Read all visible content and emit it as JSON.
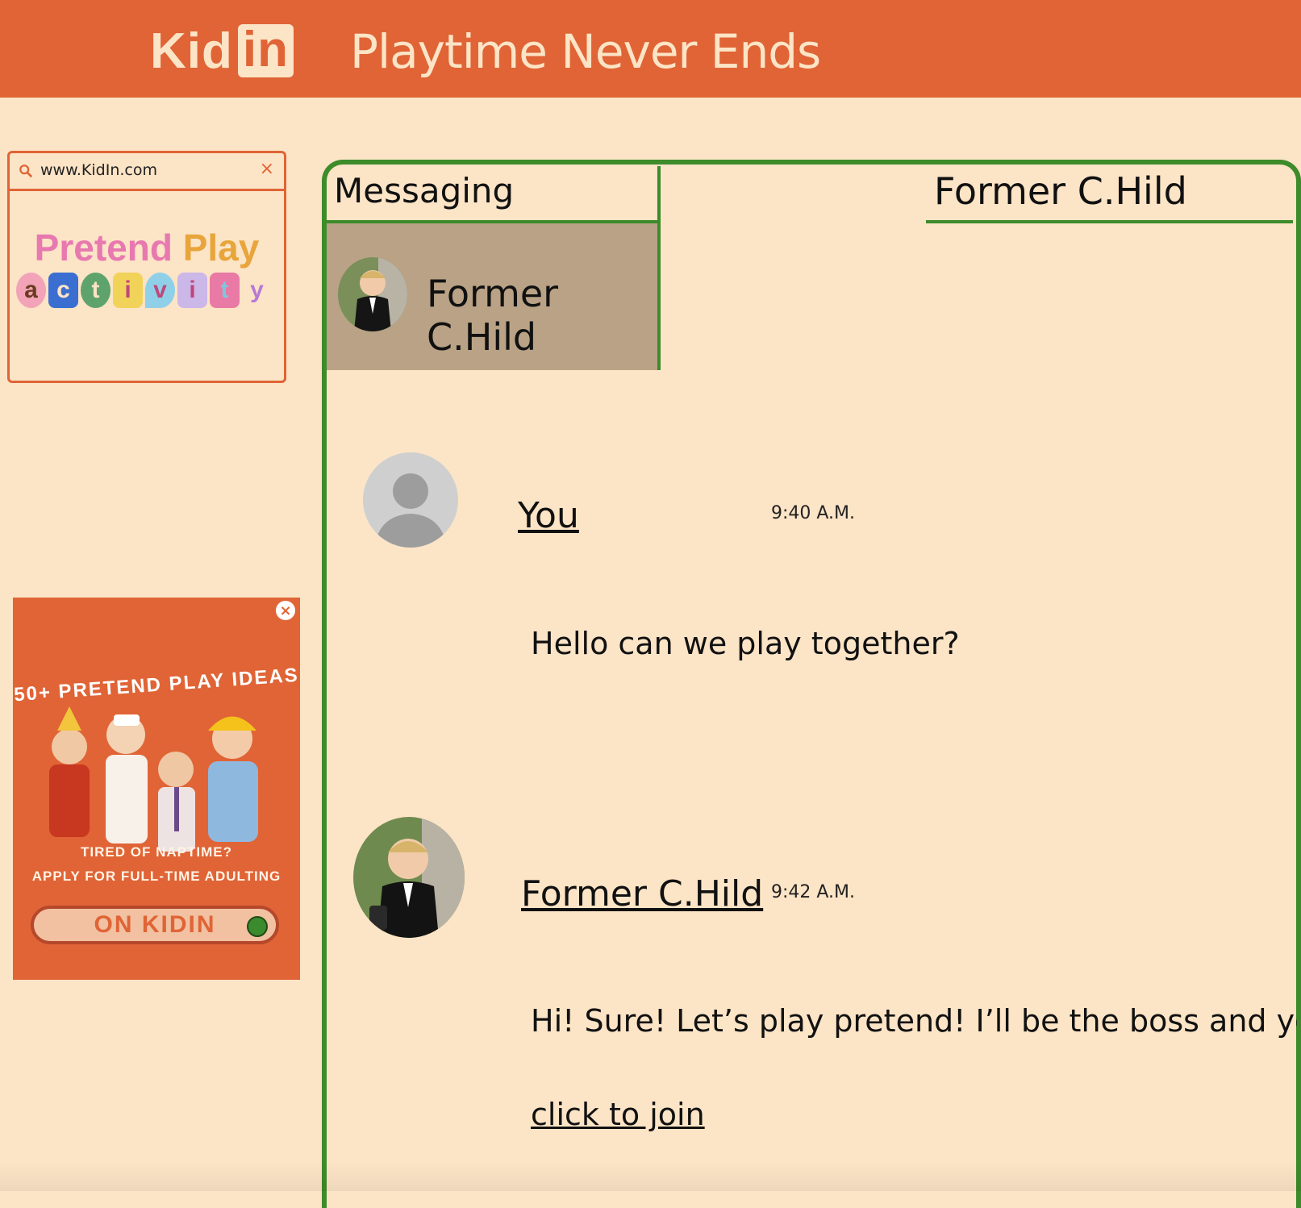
{
  "header": {
    "logo_text": "Kid",
    "logo_badge": "in",
    "tagline": "Playtime Never Ends",
    "background_color": "#e06436"
  },
  "sidebar_card": {
    "url": "www.KidIn.com",
    "close_glyph": "×",
    "title_word1": "Pretend",
    "title_word2": "Play",
    "activity_letters": [
      "a",
      "c",
      "t",
      "i",
      "v",
      "i",
      "t",
      "y"
    ]
  },
  "ad": {
    "headline": "50+ PRETEND PLAY IDEAS",
    "subline1": "TIRED OF NAPTIME?",
    "subline2": "APPLY FOR FULL-TIME ADULTING",
    "cta": "ON KIDIN",
    "close_glyph": "×"
  },
  "messaging": {
    "heading": "Messaging",
    "contacts": [
      {
        "name": "Former C.Hild"
      }
    ],
    "conversation_title": "Former C.Hild",
    "messages": [
      {
        "author": "You",
        "time": "9:40 A.M.",
        "body": "Hello can we play together?"
      },
      {
        "author": "Former C.Hild",
        "time": "9:42 A.M.",
        "body": "Hi! Sure! Let’s play pretend! I’ll be the boss and you’ll be my",
        "link": "click to join"
      }
    ],
    "accent_color": "#3d8b2a"
  }
}
